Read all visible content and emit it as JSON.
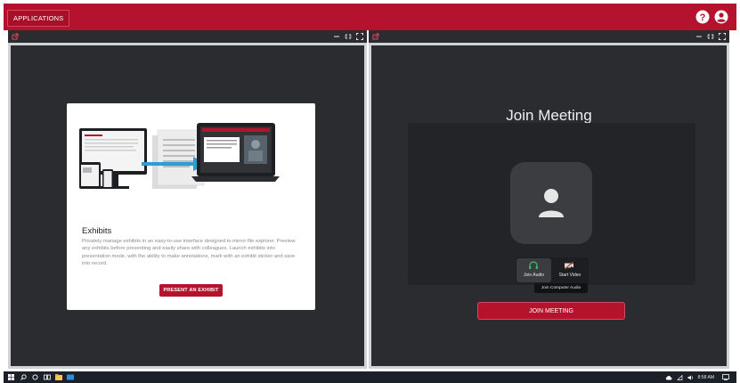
{
  "topbar": {
    "applications_label": "APPLICATIONS",
    "help_icon": "question-circle-icon",
    "user_icon": "user-circle-icon"
  },
  "panes": {
    "left": {
      "popout_icon": "external-link-icon",
      "controls": [
        "minus-icon",
        "restore-icon",
        "maximize-icon"
      ]
    },
    "right": {
      "popout_icon": "external-link-icon",
      "controls": [
        "minus-icon",
        "restore-icon",
        "maximize-icon"
      ]
    }
  },
  "exhibits": {
    "title": "Exhibits",
    "description": "Privately manage exhibits in an easy-to-use interface designed to mirror file explorer. Preview any exhibits before presenting and easily share with colleagues. Launch exhibits into presentation mode, with the ability to make annotations, mark with an exhibit sticker and save into record.",
    "present_button": "PRESENT AN EXHIBIT"
  },
  "meeting": {
    "title": "Join Meeting",
    "join_audio_label": "Join Audio",
    "start_video_label": "Start Video",
    "tooltip": "Join Computer Audio",
    "join_button": "JOIN MEETING"
  },
  "taskbar": {
    "clock": "8:58 AM"
  },
  "colors": {
    "brand_red": "#b5122e",
    "pane_dark": "#2b2c30"
  }
}
